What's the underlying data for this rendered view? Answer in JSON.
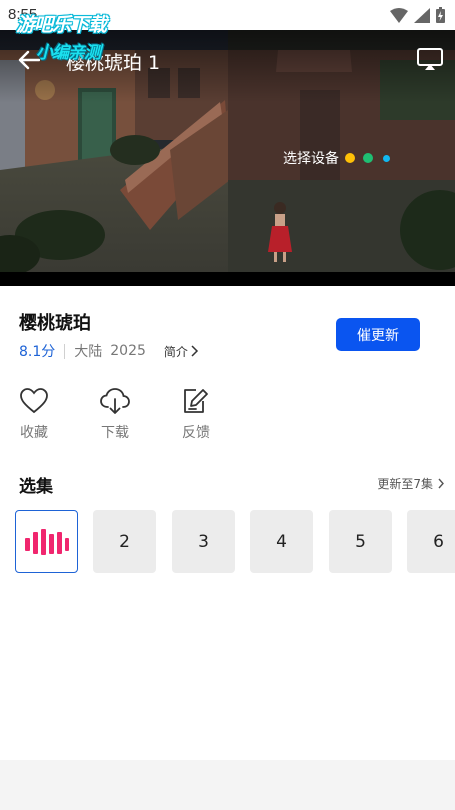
{
  "status_bar": {
    "time": "8:55"
  },
  "watermark": {
    "line1": "游吧乐下载",
    "line2": "小编亲测"
  },
  "player": {
    "title": "樱桃琥珀 1",
    "select_device_label": "选择设备",
    "device_dots": [
      "#ffc107",
      "#1fbf73",
      "#12b8f0"
    ]
  },
  "show": {
    "title": "樱桃琥珀",
    "rating": "8.1分",
    "region": "大陆",
    "year": "2025",
    "intro_label": "简介",
    "update_button": "催更新"
  },
  "actions": [
    {
      "label": "收藏",
      "icon": "heart-icon"
    },
    {
      "label": "下载",
      "icon": "cloud-download-icon"
    },
    {
      "label": "反馈",
      "icon": "edit-feedback-icon"
    }
  ],
  "episodes": {
    "title": "选集",
    "more_label": "更新至7集",
    "items": [
      "2",
      "3",
      "4",
      "5",
      "6"
    ],
    "active_color": "#f0266e"
  },
  "colors": {
    "accent": "#0a55f0",
    "rating": "#1e63d6"
  }
}
